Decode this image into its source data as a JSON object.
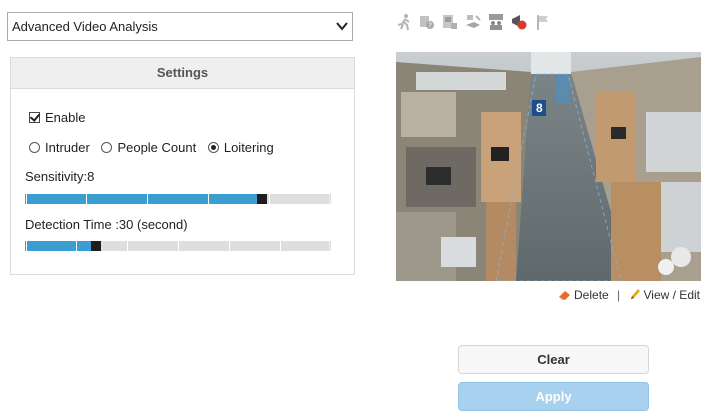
{
  "analysis_select": {
    "value": "Advanced Video Analysis"
  },
  "settings": {
    "title": "Settings",
    "enable_label": "Enable",
    "enable_checked": true,
    "modes": [
      {
        "label": "Intruder",
        "selected": false
      },
      {
        "label": "People Count",
        "selected": false
      },
      {
        "label": "Loitering",
        "selected": true
      }
    ],
    "sensitivity": {
      "label": "Sensitivity:8",
      "value": 8,
      "max": 10
    },
    "detection_time": {
      "label": "Detection Time :30 (second)",
      "level_fraction": 0.23
    }
  },
  "toolbar": {
    "icons": [
      "running-person-icon",
      "camera-help-icon",
      "tamper-icon",
      "object-removed-icon",
      "crowd-icon",
      "red-alert-icon",
      "flag-icon"
    ]
  },
  "camera": {
    "zone_number": "8"
  },
  "links": {
    "delete_label": "Delete",
    "separator": "|",
    "view_edit_label": "View / Edit"
  },
  "buttons": {
    "clear_label": "Clear",
    "apply_label": "Apply"
  },
  "colors": {
    "accent": "#3a9ed3",
    "apply_bg": "#a8d1ef",
    "thumb": "#1e1e1e"
  }
}
